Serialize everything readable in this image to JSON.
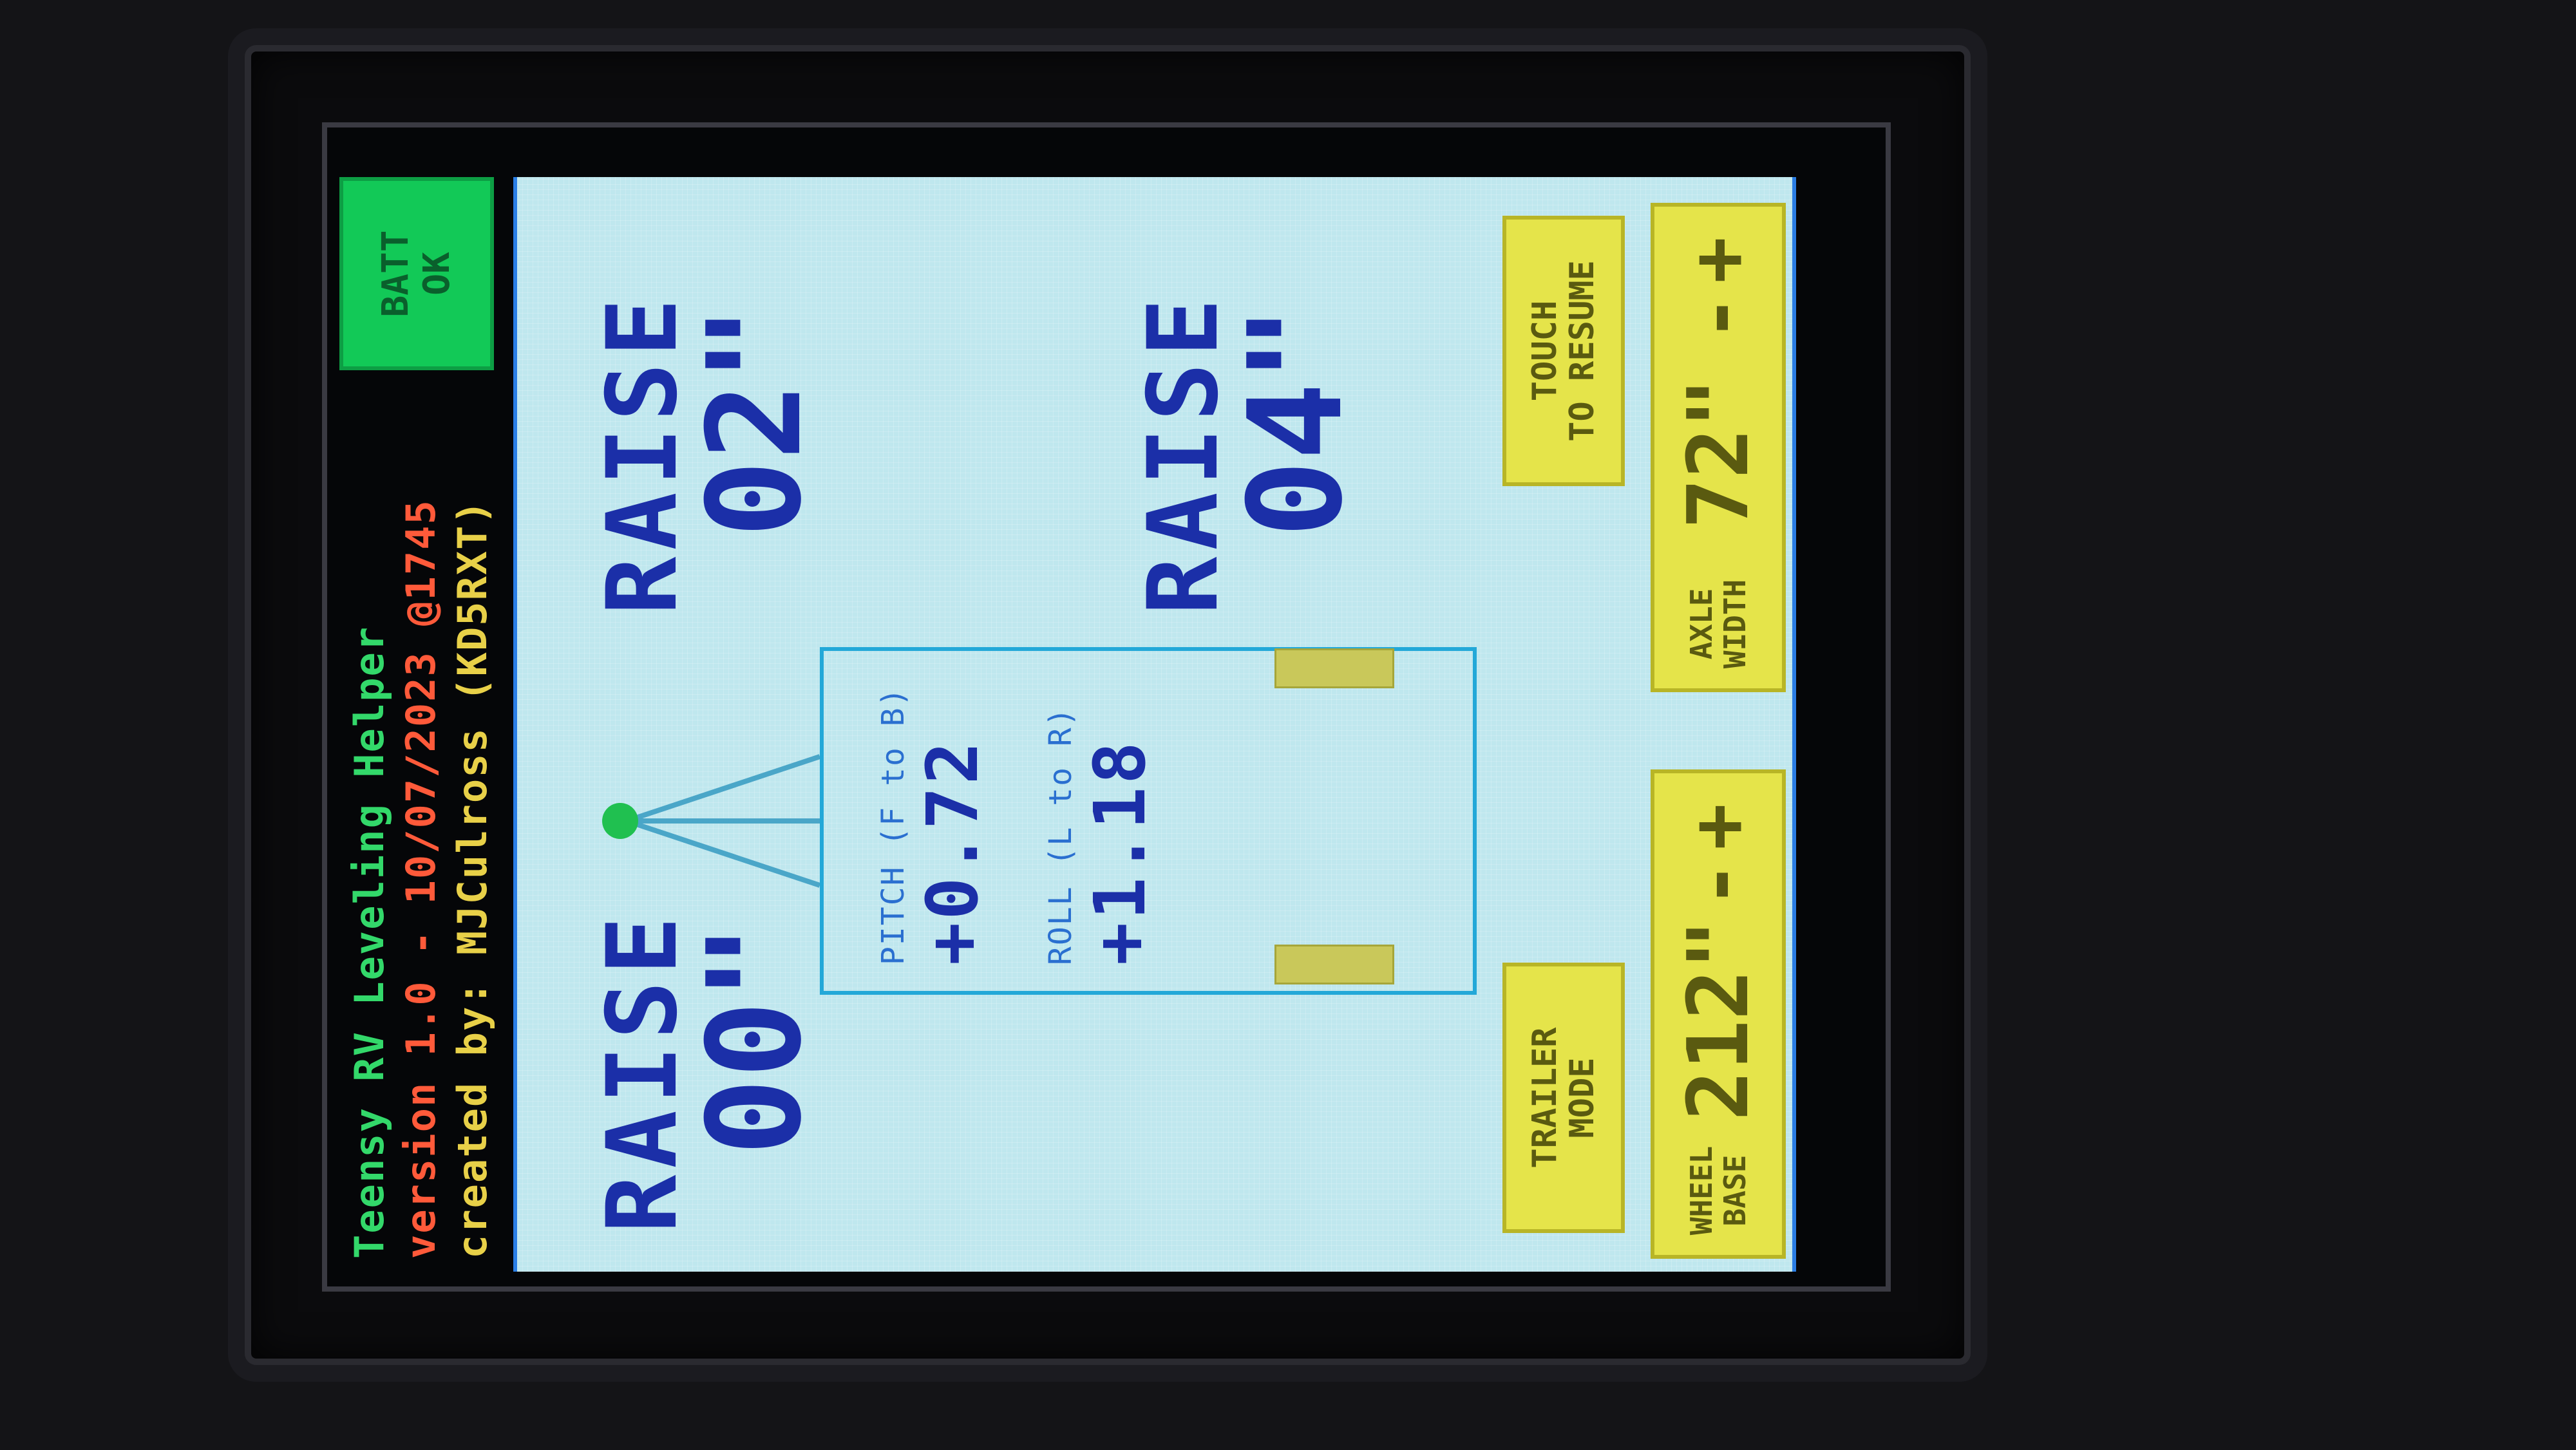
{
  "header": {
    "app_title": "Teensy RV Leveling Helper",
    "version": "version 1.0 - 10/07/2023 @1745",
    "author": "created by: MJCulross (KD5RXT)"
  },
  "battery": {
    "line1": "BATT",
    "line2": "OK",
    "color": "#12c957"
  },
  "corners": {
    "front_left": {
      "label": "RAISE",
      "amount": "00\""
    },
    "front_right": {
      "label": "RAISE",
      "amount": "02\""
    },
    "rear_left": {
      "label": "RAISE",
      "amount": "04\""
    },
    "rear_right": {
      "label": "",
      "amount": ""
    }
  },
  "readouts": {
    "pitch_label": "PITCH (F to B)",
    "pitch_value": "+0.72",
    "roll_label": "ROLL (L to R)",
    "roll_value": "+1.18"
  },
  "buttons": {
    "trailer_mode_line1": "TRAILER",
    "trailer_mode_line2": "MODE",
    "resume_line1": "TOUCH",
    "resume_line2": "TO RESUME"
  },
  "wheel_base": {
    "cap1": "WHEEL",
    "cap2": "BASE",
    "value": "212\"",
    "plus": "+",
    "minus": "-"
  },
  "axle_width": {
    "cap1": "AXLE",
    "cap2": "WIDTH",
    "value": "72\"",
    "plus": "+",
    "minus": "-"
  },
  "colors": {
    "screen_bg": "#bfe7ee",
    "accent_blue": "#1b2fa8",
    "button_yellow": "#e5e44a",
    "title_green": "#33d86a",
    "version_red": "#ff5a3a",
    "author_yellow": "#e8d048"
  }
}
